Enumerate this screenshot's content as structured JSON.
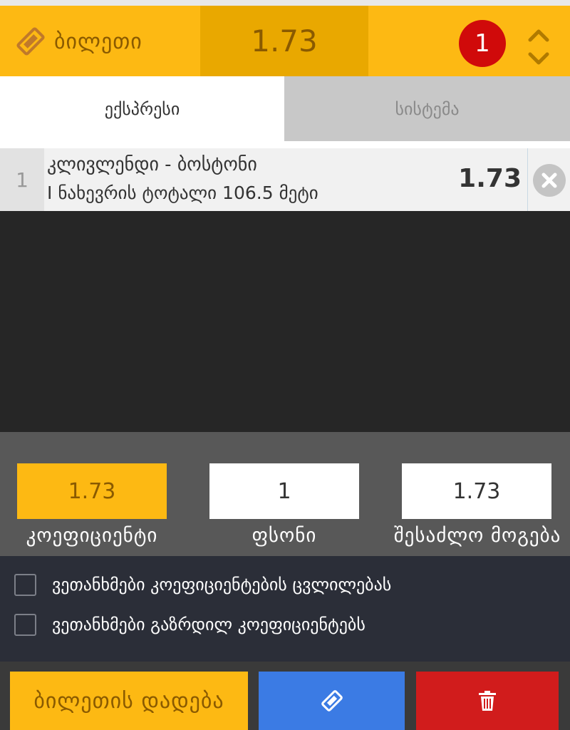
{
  "header": {
    "ticket_label": "ბილეთი",
    "total_odds": "1.73",
    "bet_count": "1"
  },
  "tabs": {
    "express": "ექსპრესი",
    "system": "სისტემა"
  },
  "bets": [
    {
      "index": "1",
      "match": "კლივლენდი - ბოსტონი",
      "market": "I ნახევრის ტოტალი      106.5 მეტი",
      "odds": "1.73"
    }
  ],
  "stake": {
    "coefficient_value": "1.73",
    "amount_value": "1",
    "possible_win_value": "1.73",
    "coefficient_label": "კოეფიციენტი",
    "amount_label": "ფსონი",
    "possible_win_label": "შესაძლო მოგება"
  },
  "options": {
    "accept_odds_change": "ვეთანხმები კოეფიციენტების ცვლილებას",
    "accept_boosted_odds": "ვეთანხმები გაზრდილ კოეფიციენტებს"
  },
  "actions": {
    "place_bet": "ბილეთის დადება"
  },
  "colors": {
    "accent": "#fdb913",
    "accent_dark": "#e9a800",
    "badge": "#d00a0a",
    "share": "#3b7be4",
    "clear": "#d11c1c"
  },
  "icons": {
    "header_ticket": "ticket-icon",
    "collapse": "chevron-up-down-icon",
    "remove": "close-circle-icon",
    "share": "ticket-icon",
    "clear": "trash-icon"
  }
}
